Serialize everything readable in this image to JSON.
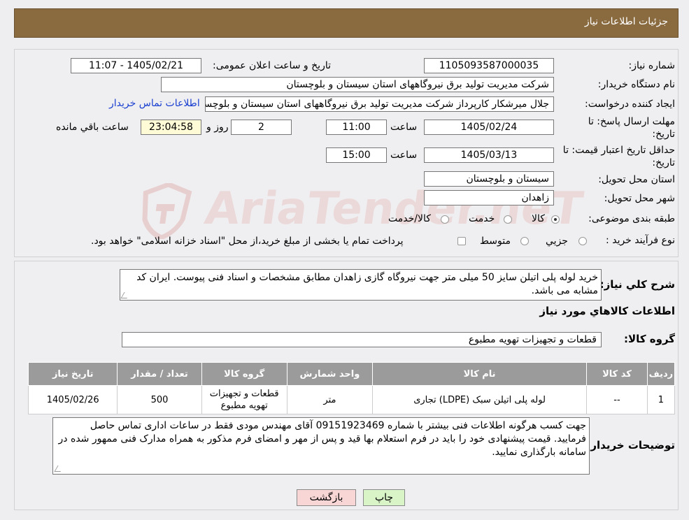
{
  "header": {
    "title": "جزئیات اطلاعات نیاز"
  },
  "labels": {
    "need_number": "شماره نیاز:",
    "announce_datetime": "تاریخ و ساعت اعلان عمومی:",
    "buyer_org": "نام دستگاه خریدار:",
    "requester": "ایجاد کننده درخواست:",
    "contact_link": "اطلاعات تماس خریدار",
    "deadline_line1": "مهلت ارسال پاسخ: تا",
    "deadline_line2": "تاریخ:",
    "time_word": "ساعت",
    "day_word": "روز و",
    "remaining_word": "ساعت باقي مانده",
    "validity_line1": "حداقل تاریخ اعتبار قیمت: تا",
    "validity_line2": "تاریخ:",
    "province": "استان محل تحویل:",
    "city": "شهر محل تحویل:",
    "category": "طبقه بندی موضوعی:",
    "process_type": "نوع فرآیند خرید :",
    "description": "شرح کلي نیاز:",
    "goods_info": "اطلاعات کالاهاي مورد نیاز",
    "goods_group": "گروه کالا:",
    "buyer_notes": "توضیحات خریدار:"
  },
  "values": {
    "need_number": "1105093587000035",
    "announce_datetime": "1405/02/21 - 11:07",
    "buyer_org": "شرکت مدیریت تولید برق نیروگاههای استان سیستان و بلوچستان",
    "requester": "جلال میرشکار کارپرداز شرکت مدیریت تولید برق نیروگاههای استان سیستان و بلوچستان",
    "deadline_date": "1405/02/24",
    "deadline_time": "11:00",
    "days": "2",
    "remaining_time": "23:04:58",
    "validity_date": "1405/03/13",
    "validity_time": "15:00",
    "province": "سیستان و بلوچستان",
    "city": "زاهدان",
    "description": "خرید لوله پلی اتیلن سایز 50 میلی متر جهت نیروگاه گازی زاهدان مطابق مشخصات و اسناد فنی پیوست. ایران کد مشابه می باشد.",
    "goods_group": "قطعات و تجهیزات تهویه مطبوع",
    "buyer_notes": "جهت کسب هرگونه اطلاعات فنی بیشتر با شماره 09151923469 آقای مهندس مودی فقط در ساعات اداری تماس حاصل فرمایید. قیمت پیشنهادی خود را باید در فرم استعلام بها قید و پس از مهر و امضای فرم مذکور به همراه مدارک فنی ممهور شده در سامانه بارگذاری نمایید."
  },
  "category_options": [
    {
      "label": "کالا",
      "selected": true
    },
    {
      "label": "خدمت",
      "selected": false
    },
    {
      "label": "کالا/خدمت",
      "selected": false
    }
  ],
  "process_options": [
    {
      "label": "جزیي",
      "selected": false
    },
    {
      "label": "متوسط",
      "selected": false
    }
  ],
  "process_note": "پرداخت تمام یا بخشی از مبلغ خرید،از محل \"اسناد خزانه اسلامی\" خواهد بود.",
  "table": {
    "headers": [
      "ردیف",
      "کد کالا",
      "نام کالا",
      "واحد شمارش",
      "گروه کالا",
      "تعداد / مقدار",
      "تاریخ نیاز"
    ],
    "rows": [
      [
        "1",
        "--",
        "لوله پلی اتیلن سبک (LDPE) تجاری",
        "متر",
        "قطعات و تجهیزات تهویه مطبوع",
        "500",
        "1405/02/26"
      ]
    ]
  },
  "buttons": {
    "print": "چاپ",
    "back": "بازگشت"
  },
  "watermark": "AriaTender.neT",
  "colors": {
    "header_bg": "#8a6b3f",
    "remaining_bg": "#fffbd6",
    "print_bg": "#d9f5c8",
    "back_bg": "#f9d6d6",
    "link": "#1a3fd0"
  }
}
